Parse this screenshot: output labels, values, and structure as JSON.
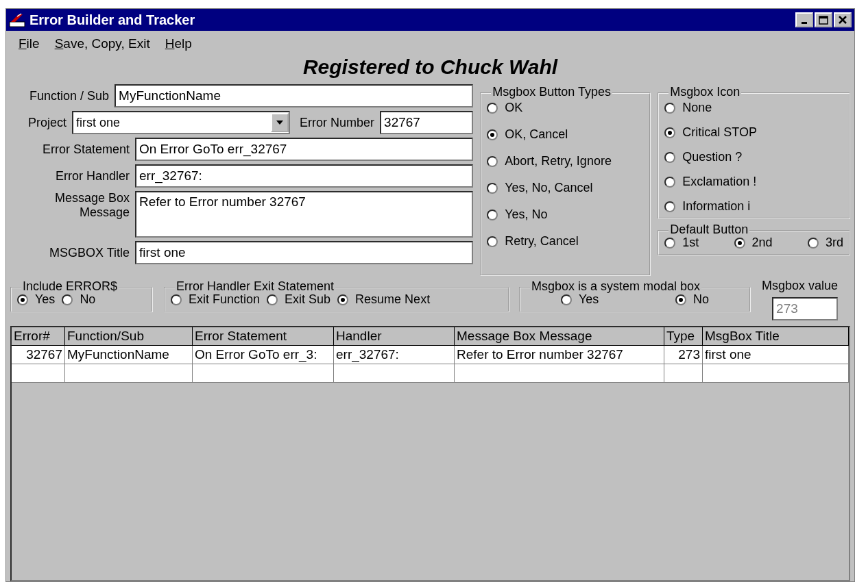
{
  "window": {
    "title": "Error Builder and Tracker"
  },
  "menu": [
    {
      "label": "File"
    },
    {
      "label": "Save, Copy, Exit"
    },
    {
      "label": "Help"
    }
  ],
  "heading": "Registered to Chuck Wahl",
  "form": {
    "function_sub": {
      "label": "Function / Sub",
      "value": "MyFunctionName"
    },
    "project": {
      "label": "Project",
      "value": "first one"
    },
    "error_number": {
      "label": "Error Number",
      "value": "32767"
    },
    "error_statement": {
      "label": "Error Statement",
      "value": "On Error GoTo err_32767"
    },
    "error_handler": {
      "label": "Error Handler",
      "value": "err_32767:"
    },
    "message": {
      "label_lines": [
        "Message Box",
        "Message"
      ],
      "value": "Refer to Error number 32767"
    },
    "msgbox_title": {
      "label": "MSGBOX Title",
      "value": "first one"
    }
  },
  "button_types": {
    "title": "Msgbox Button Types",
    "options": [
      {
        "label": "OK",
        "selected": false
      },
      {
        "label": "OK, Cancel",
        "selected": true
      },
      {
        "label": "Abort, Retry, Ignore",
        "selected": false
      },
      {
        "label": "Yes, No, Cancel",
        "selected": false
      },
      {
        "label": "Yes, No",
        "selected": false
      },
      {
        "label": "Retry, Cancel",
        "selected": false
      }
    ]
  },
  "icon_group": {
    "title": "Msgbox Icon",
    "options": [
      {
        "label": "None",
        "selected": false
      },
      {
        "label": "Critical STOP",
        "selected": true
      },
      {
        "label": "Question ?",
        "selected": false
      },
      {
        "label": "Exclamation !",
        "selected": false
      },
      {
        "label": "Information i",
        "selected": false
      }
    ]
  },
  "default_button": {
    "title": "Default Button",
    "options": [
      {
        "label": "1st",
        "selected": false
      },
      {
        "label": "2nd",
        "selected": true
      },
      {
        "label": "3rd",
        "selected": false
      }
    ]
  },
  "include_error": {
    "title": "Include ERROR$",
    "options": [
      {
        "label": "Yes",
        "selected": true
      },
      {
        "label": "No",
        "selected": false
      }
    ]
  },
  "exit_statement": {
    "title": "Error Handler Exit Statement",
    "options": [
      {
        "label": "Exit Function",
        "selected": false
      },
      {
        "label": "Exit Sub",
        "selected": false
      },
      {
        "label": "Resume Next",
        "selected": true
      }
    ]
  },
  "system_modal": {
    "title": "Msgbox is a system modal box",
    "options": [
      {
        "label": "Yes",
        "selected": false
      },
      {
        "label": "No",
        "selected": true
      }
    ]
  },
  "msgbox_value": {
    "label": "Msgbox value",
    "value": "273",
    "disabled": true
  },
  "table": {
    "columns": [
      "Error#",
      "Function/Sub",
      "Error Statement",
      "Handler",
      "Message Box Message",
      "Type",
      "MsgBox Title"
    ],
    "rows": [
      [
        "32767",
        "MyFunctionName",
        "On Error GoTo err_3:",
        "err_32767:",
        "Refer to Error number 32767",
        "273",
        "first one"
      ],
      [
        "",
        "",
        "",
        "",
        "",
        "",
        ""
      ]
    ]
  }
}
